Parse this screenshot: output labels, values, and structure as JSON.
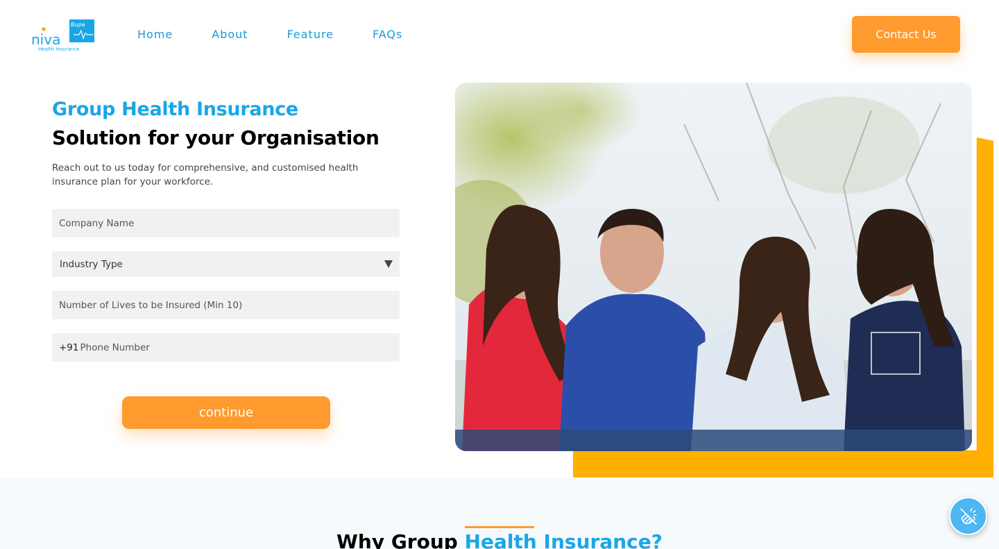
{
  "brand": {
    "logo_text": "niva",
    "logo_sub": "Health Insurance",
    "logo_badge": "Bupa"
  },
  "nav": {
    "items": [
      {
        "label": "Home"
      },
      {
        "label": "About"
      },
      {
        "label": "Feature"
      },
      {
        "label": "FAQs"
      }
    ],
    "contact_label": "Contact Us"
  },
  "hero": {
    "title_line1": "Group Health Insurance",
    "title_line2": "Solution for your Organisation",
    "description": "Reach out to us today for comprehensive, and customised health insurance plan for your workforce."
  },
  "form": {
    "company_placeholder": "Company Name",
    "industry_selected": "Industry Type",
    "lives_placeholder": "Number of Lives to be Insured (Min 10)",
    "phone_prefix": "+91",
    "phone_placeholder": "Phone Number",
    "submit_label": "continue"
  },
  "why": {
    "title_prefix": "Why Group ",
    "title_highlight": "Health Insurance?"
  },
  "colors": {
    "primary_blue": "#1aa6e6",
    "accent_orange": "#ff9a2e",
    "accent_yellow": "#ffb000"
  },
  "icons": {
    "dropdown": "chevron-down-icon",
    "fab": "accessibility-hand-icon"
  }
}
